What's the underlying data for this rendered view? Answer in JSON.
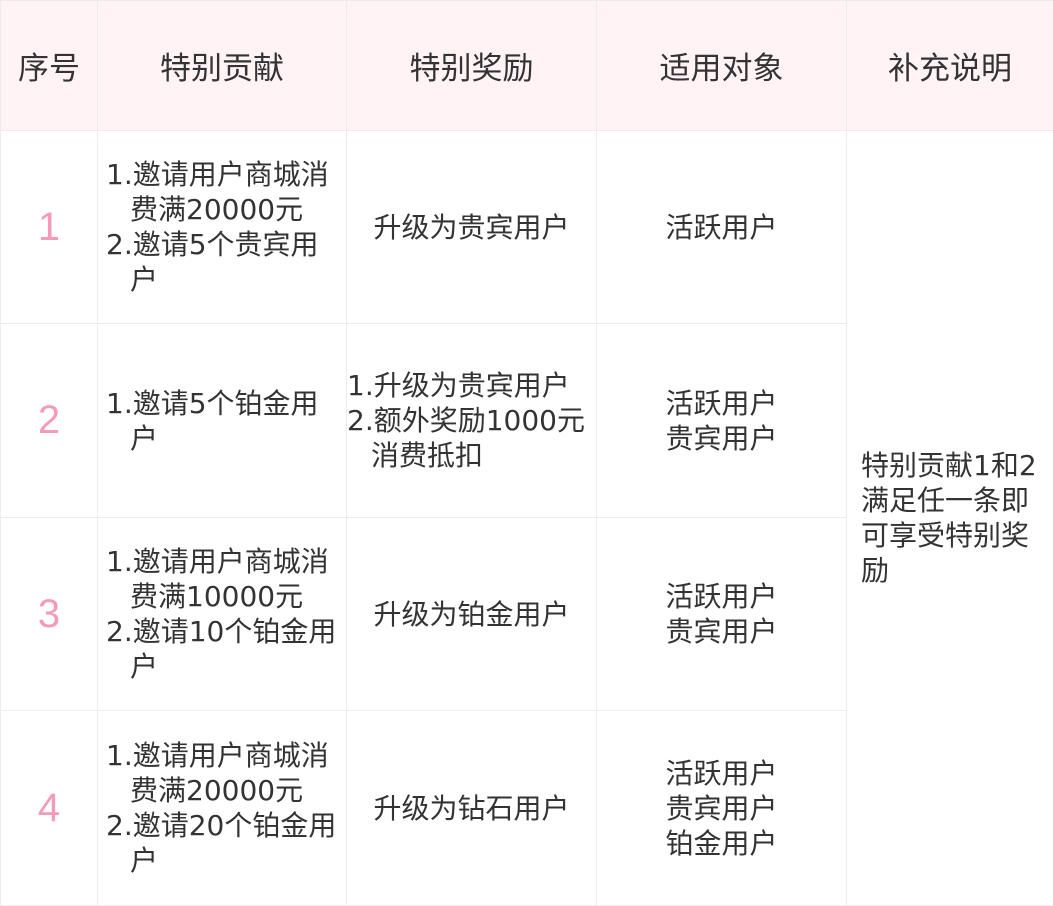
{
  "headers": {
    "index": "序号",
    "contribution": "特别贡献",
    "reward": "特别奖励",
    "target": "适用对象",
    "note": "补充说明"
  },
  "rows": [
    {
      "index": "1",
      "contribution": [
        "1.邀请用户商城消费满20000元",
        "2.邀请5个贵宾用户"
      ],
      "reward": [
        "升级为贵宾用户"
      ],
      "target": [
        "活跃用户"
      ]
    },
    {
      "index": "2",
      "contribution": [
        "1.邀请5个铂金用户"
      ],
      "reward": [
        "1.升级为贵宾用户",
        "2.额外奖励1000元消费抵扣"
      ],
      "target": [
        "活跃用户",
        "贵宾用户"
      ]
    },
    {
      "index": "3",
      "contribution": [
        "1.邀请用户商城消费满10000元",
        "2.邀请10个铂金用户"
      ],
      "reward": [
        "升级为铂金用户"
      ],
      "target": [
        "活跃用户",
        "贵宾用户"
      ]
    },
    {
      "index": "4",
      "contribution": [
        "1.邀请用户商城消费满20000元",
        "2.邀请20个铂金用户"
      ],
      "reward": [
        "升级为钻石用户"
      ],
      "target": [
        "活跃用户",
        "贵宾用户",
        "铂金用户"
      ]
    }
  ],
  "note": "特别贡献1和2满足任一条即可享受特别奖励",
  "colors": {
    "header_bg": "#fff3f6",
    "index_pink": "#f59bb8",
    "border": "#ececec",
    "text": "#333333"
  }
}
